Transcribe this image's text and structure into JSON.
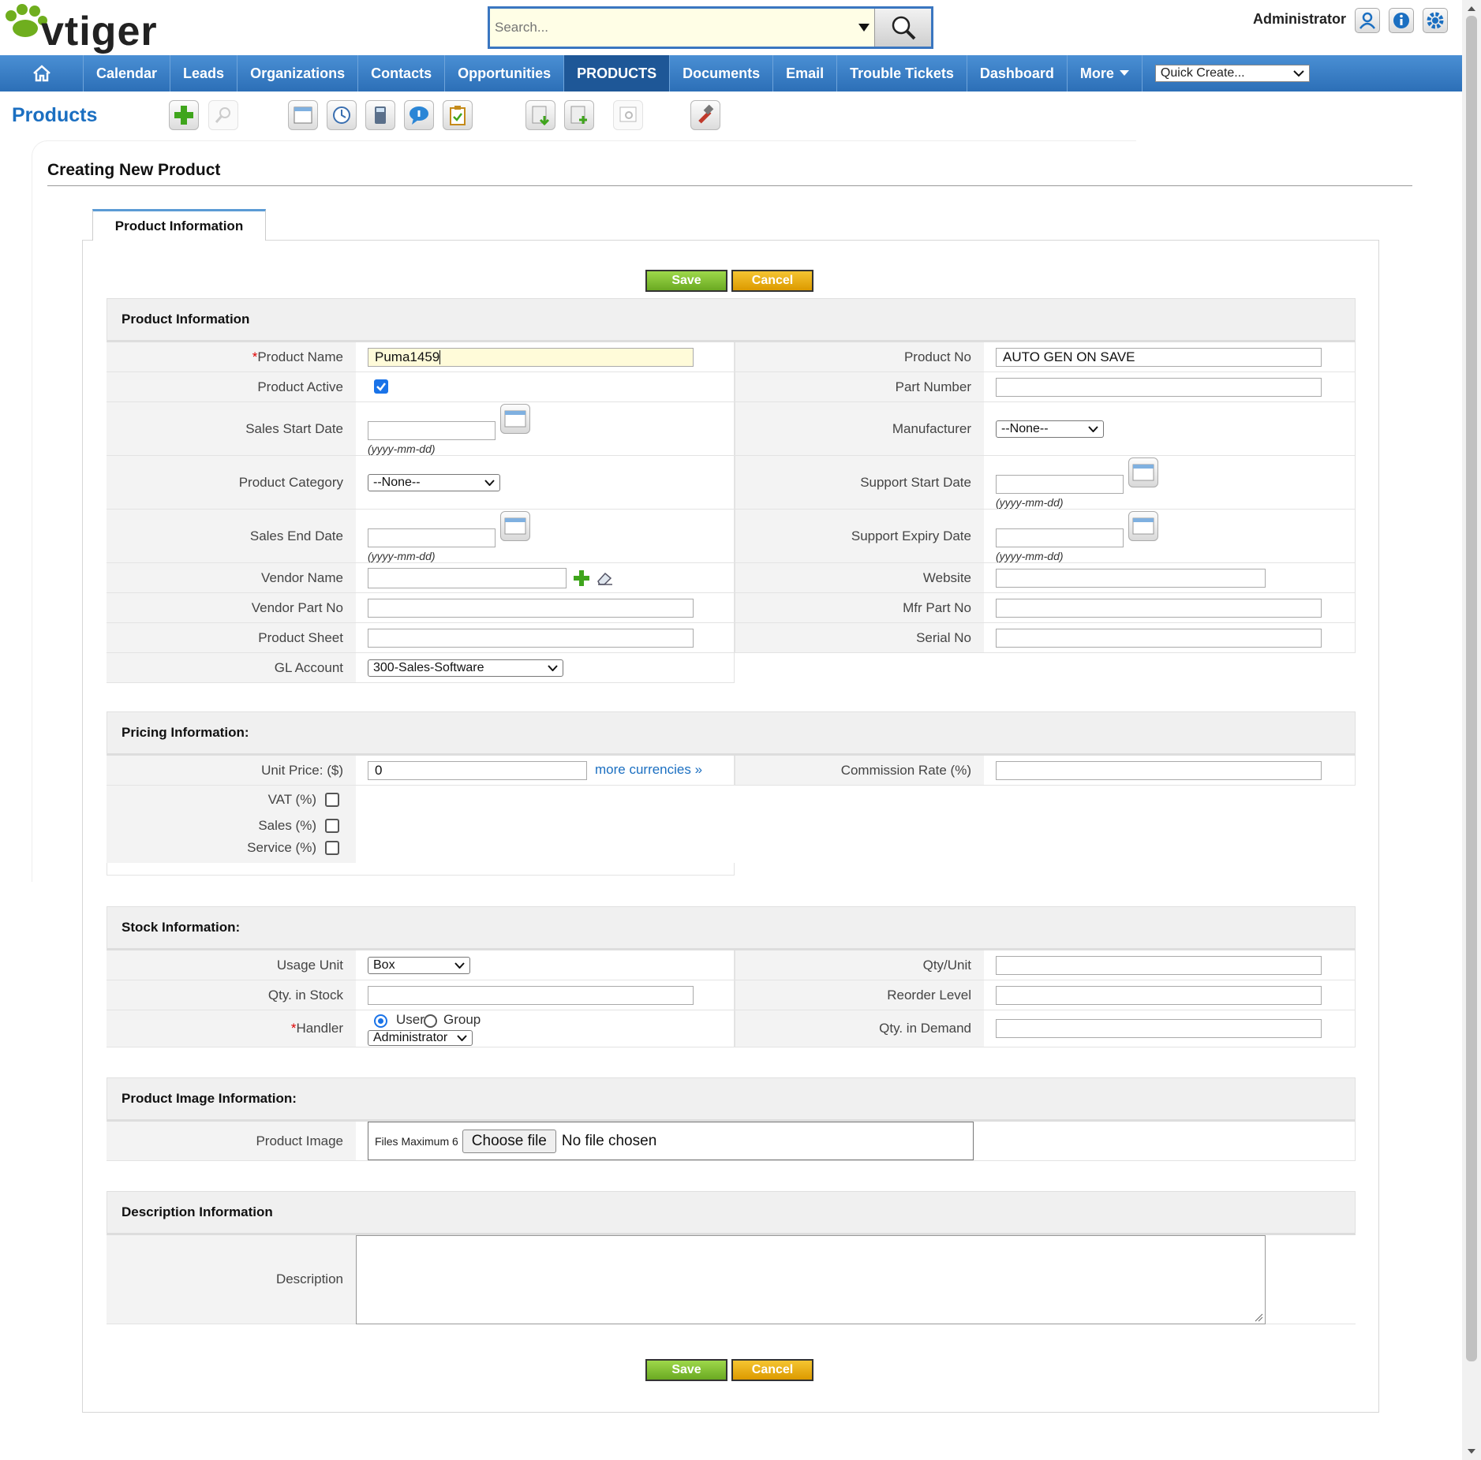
{
  "header": {
    "logo_text": "vtiger",
    "search_placeholder": "Search...",
    "user": "Administrator"
  },
  "nav": {
    "items": [
      "Calendar",
      "Leads",
      "Organizations",
      "Contacts",
      "Opportunities",
      "PRODUCTS",
      "Documents",
      "Email",
      "Trouble Tickets",
      "Dashboard",
      "More"
    ],
    "active": "PRODUCTS",
    "quick_create": "Quick Create..."
  },
  "page": {
    "module_title": "Products",
    "form_title": "Creating New Product",
    "tab_label": "Product Information",
    "save_label": "Save",
    "cancel_label": "Cancel"
  },
  "product_info": {
    "header": "Product Information",
    "product_name_label": "Product Name",
    "product_name_value": "Puma1459",
    "product_no_label": "Product No",
    "product_no_value": "AUTO GEN ON SAVE",
    "product_active_label": "Product Active",
    "part_number_label": "Part Number",
    "sales_start_label": "Sales Start Date",
    "manufacturer_label": "Manufacturer",
    "manufacturer_value": "--None--",
    "category_label": "Product Category",
    "category_value": "--None--",
    "support_start_label": "Support Start Date",
    "sales_end_label": "Sales End Date",
    "support_expiry_label": "Support Expiry Date",
    "vendor_name_label": "Vendor Name",
    "website_label": "Website",
    "vendor_part_label": "Vendor Part No",
    "mfr_part_label": "Mfr Part No",
    "product_sheet_label": "Product Sheet",
    "serial_no_label": "Serial No",
    "gl_account_label": "GL Account",
    "gl_account_value": "300-Sales-Software",
    "date_hint": "(yyyy-mm-dd)"
  },
  "pricing": {
    "header": "Pricing Information:",
    "unit_price_label": "Unit Price: ($)",
    "unit_price_value": "0",
    "more_currencies": "more currencies »",
    "commission_label": "Commission Rate (%)",
    "vat_label": "VAT (%)",
    "sales_label": "Sales (%)",
    "service_label": "Service (%)"
  },
  "stock": {
    "header": "Stock Information:",
    "usage_unit_label": "Usage Unit",
    "usage_unit_value": "Box",
    "qty_unit_label": "Qty/Unit",
    "qty_stock_label": "Qty. in Stock",
    "reorder_label": "Reorder Level",
    "handler_label": "Handler",
    "handler_user": "User",
    "handler_group": "Group",
    "handler_value": "Administrator",
    "qty_demand_label": "Qty. in Demand"
  },
  "image_info": {
    "header": "Product Image Information:",
    "label": "Product Image",
    "files_max": "Files Maximum 6",
    "choose_file": "Choose file",
    "no_file": "No file chosen"
  },
  "description": {
    "header": "Description Information",
    "label": "Description"
  }
}
